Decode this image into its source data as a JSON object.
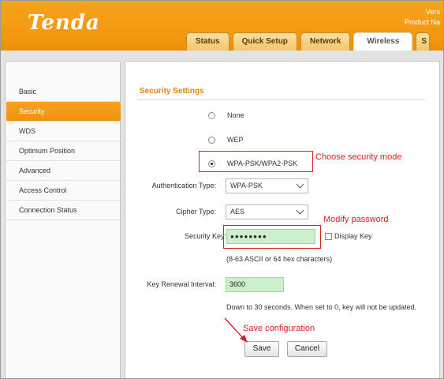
{
  "header": {
    "logo": "Tenda",
    "version_line1": "Vers",
    "version_line2": "Product Na"
  },
  "tabs": [
    {
      "label": "Status",
      "active": false
    },
    {
      "label": "Quick Setup",
      "active": false
    },
    {
      "label": "Network",
      "active": false
    },
    {
      "label": "Wireless",
      "active": true
    },
    {
      "label": "S",
      "active": false
    }
  ],
  "sidebar": {
    "items": [
      {
        "label": "Basic",
        "active": false
      },
      {
        "label": "Security",
        "active": true
      },
      {
        "label": "WDS",
        "active": false
      },
      {
        "label": "Optimum Position",
        "active": false
      },
      {
        "label": "Advanced",
        "active": false
      },
      {
        "label": "Access Control",
        "active": false
      },
      {
        "label": "Connection Status",
        "active": false
      }
    ]
  },
  "main": {
    "section_title": "Security Settings",
    "modes": [
      {
        "label": "None",
        "checked": false
      },
      {
        "label": "WEP",
        "checked": false
      },
      {
        "label": "WPA-PSK/WPA2-PSK",
        "checked": true
      }
    ],
    "auth_type_label": "Authentication Type:",
    "auth_type_value": "WPA-PSK",
    "cipher_type_label": "Cipher Type:",
    "cipher_type_value": "AES",
    "security_key_label": "Security Key:",
    "security_key_value": "●●●●●●●●",
    "display_key_label": "Display Key",
    "key_hint": "(8-63 ASCII or 64 hex characters)",
    "renewal_label": "Key Renewal Interval:",
    "renewal_value": "3600",
    "renewal_hint": "Down to 30 seconds. When set to 0, key will not be updated.",
    "save_label": "Save",
    "cancel_label": "Cancel"
  },
  "annotations": {
    "security_mode": "Choose security mode",
    "password": "Modify password",
    "save": "Save configuration",
    "color": "#d81f1f"
  },
  "colors": {
    "brand_orange": "#f39a12",
    "section_title": "#e5830b",
    "input_green": "#ccf0cc"
  }
}
